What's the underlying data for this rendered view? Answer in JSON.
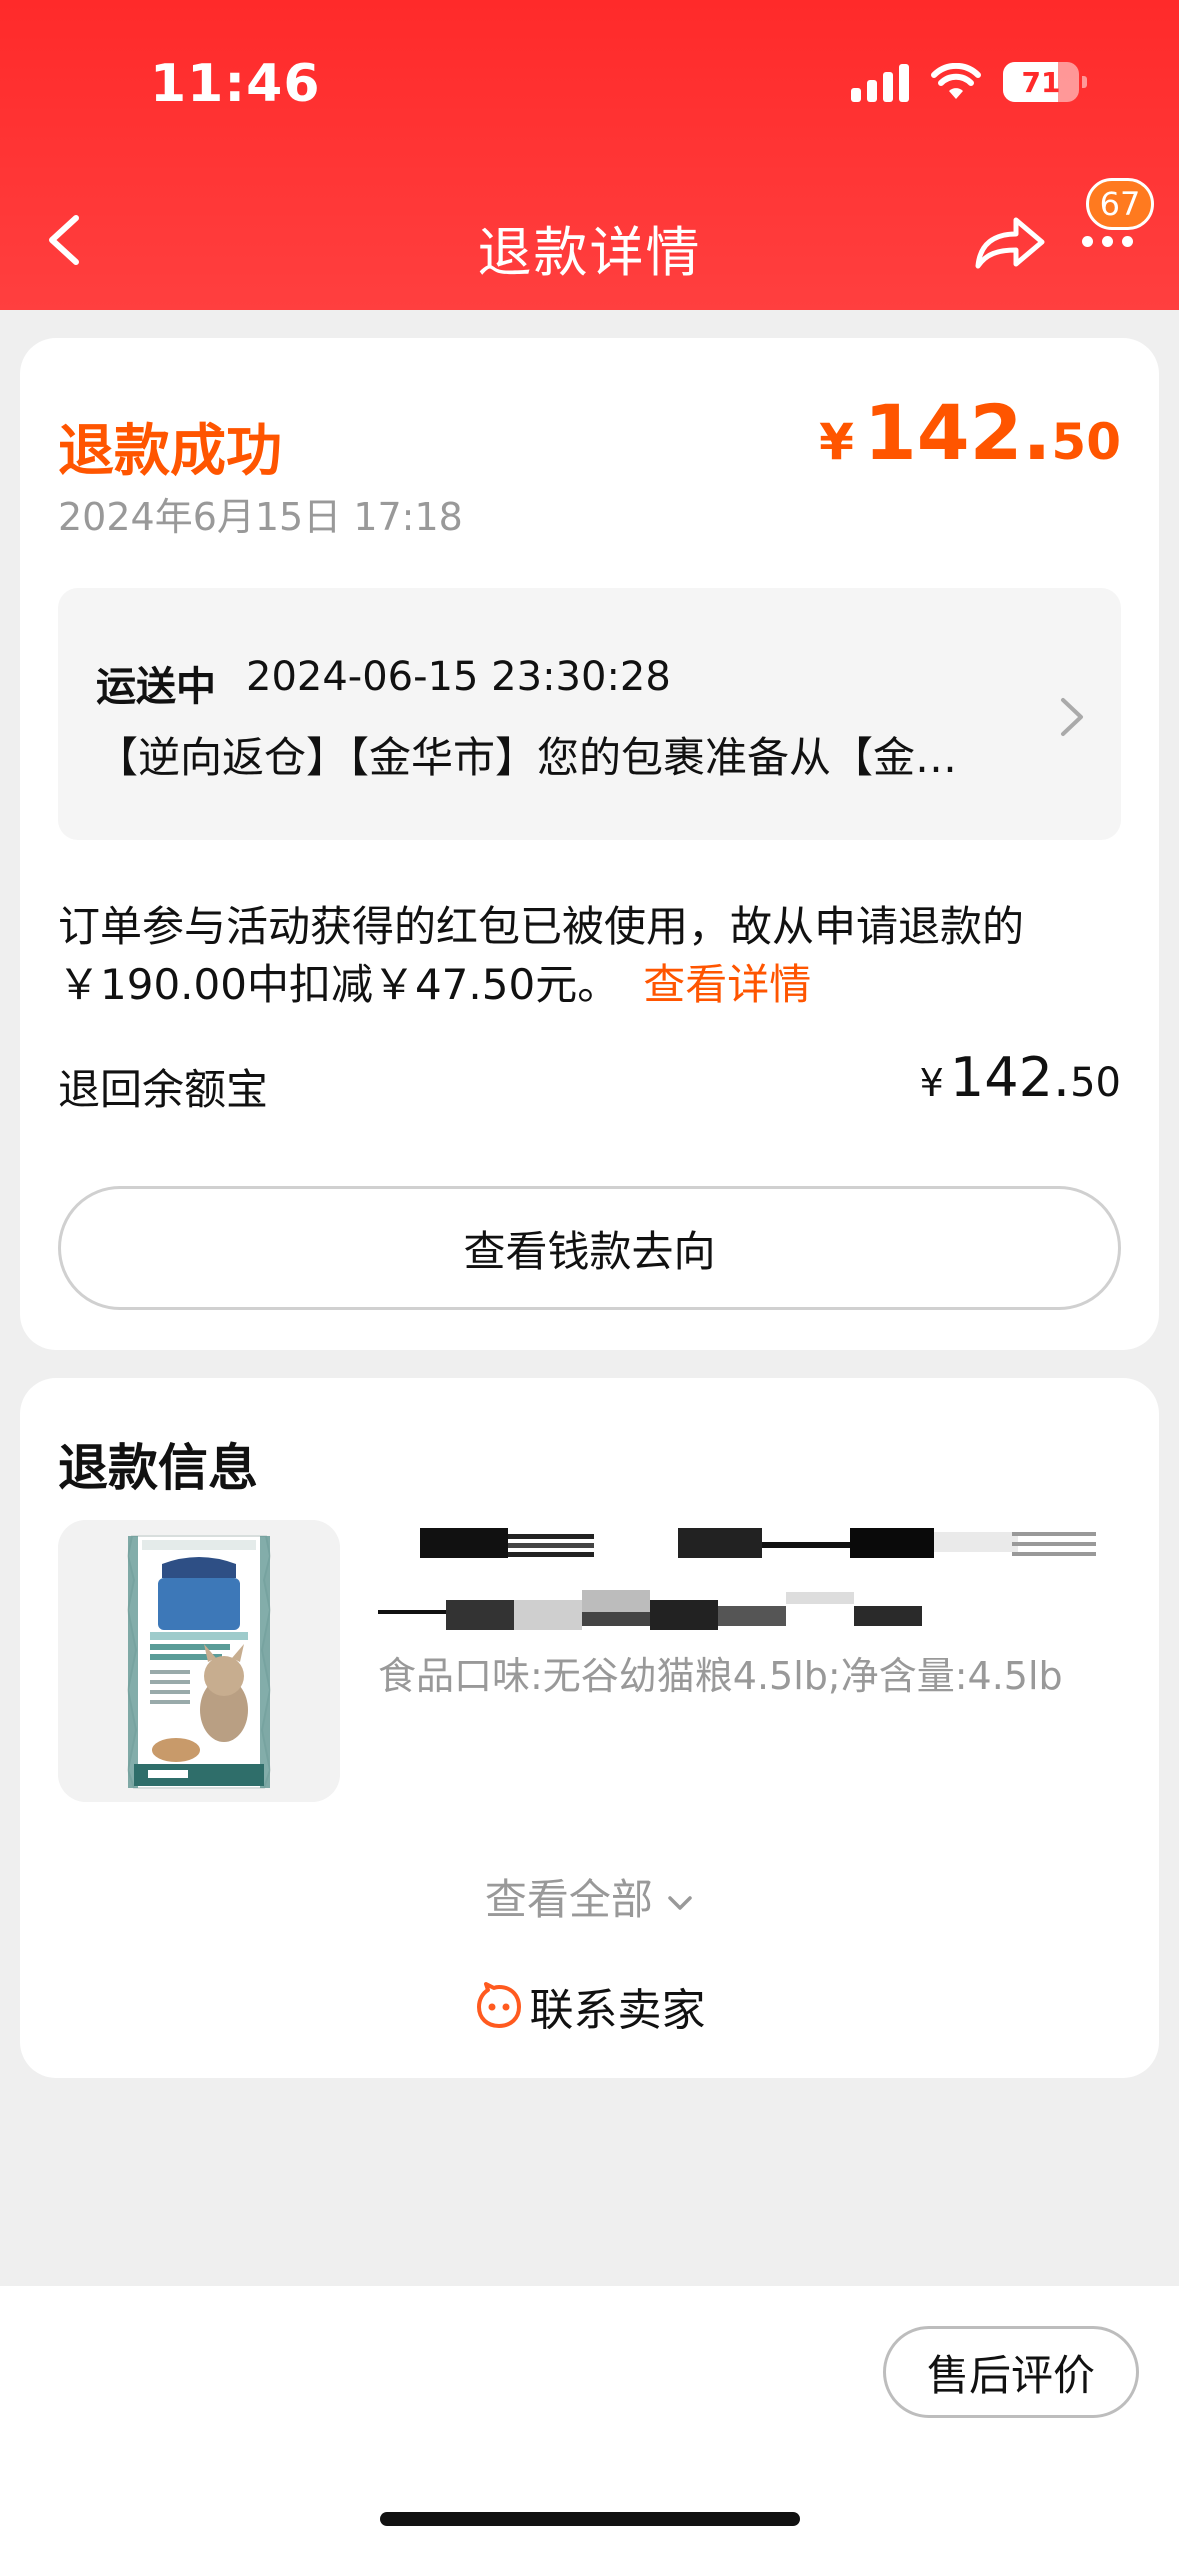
{
  "status_bar": {
    "time": "11:46",
    "battery": "71"
  },
  "nav": {
    "title": "退款详情",
    "badge": "67",
    "icons": [
      "back-icon",
      "share-icon",
      "more-icon"
    ]
  },
  "refund": {
    "status": "退款成功",
    "date": "2024年6月15日 17:18",
    "amount": {
      "currency": "¥",
      "integer": "142.",
      "decimal": "50"
    }
  },
  "logistics": {
    "status": "运送中",
    "time": "2024-06-15 23:30:28",
    "text": "【逆向返仓】【金华市】您的包裹准备从【金…"
  },
  "notice": {
    "text": "订单参与活动获得的红包已被使用，故从申请退款的￥190.00中扣减￥47.50元。",
    "link": "查看详情"
  },
  "refund_to": {
    "label": "退回余额宝",
    "amount": {
      "currency": "¥",
      "integer": "142.",
      "decimal": "50"
    }
  },
  "track_button": "查看钱款去向",
  "refund_info": {
    "title": "退款信息",
    "product_spec": "食品口味:无谷幼猫粮4.5lb;净含量:4.5lb",
    "view_all": "查看全部",
    "contact_seller": "联系卖家"
  },
  "footer": {
    "review_button": "售后评价"
  },
  "colors": {
    "header": "#ff2a2a",
    "accent": "#ff5500",
    "badge": "#ff7a1f"
  }
}
